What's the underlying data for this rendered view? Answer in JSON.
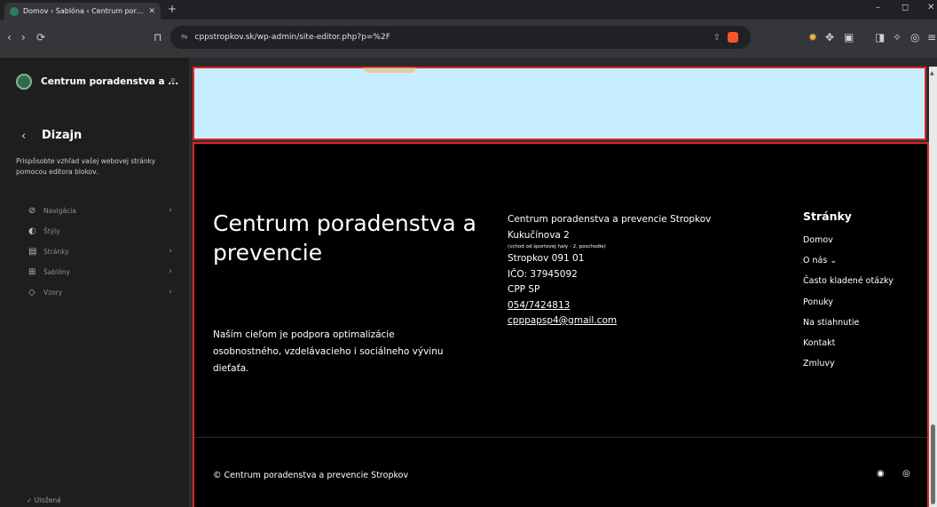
{
  "browser": {
    "tab_title": "Domov ‹ Šablóna ‹ Centrum por…",
    "new_tab": "+",
    "tab_close": "✕",
    "url": "cppstropkov.sk/wp-admin/site-editor.php?p=%2F",
    "win_min": "–",
    "win_max": "◻",
    "win_close": "✕"
  },
  "sidebar": {
    "site_name": "Centrum poradenstva a ...",
    "back": "‹",
    "heading": "Dizajn",
    "description": "Prispôsobte vzhľad vašej webovej stránky pomocou editora blokov.",
    "items": [
      {
        "label": "Navigácia",
        "icon": "compass-icon",
        "glyph": "⊘",
        "chevron": "›"
      },
      {
        "label": "Štýly",
        "icon": "half-circle-icon",
        "glyph": "◐",
        "chevron": ""
      },
      {
        "label": "Stránky",
        "icon": "page-icon",
        "glyph": "▤",
        "chevron": "›"
      },
      {
        "label": "Šablóny",
        "icon": "layout-icon",
        "glyph": "⊞",
        "chevron": "›"
      },
      {
        "label": "Vzory",
        "icon": "symbol-icon",
        "glyph": "◇",
        "chevron": "›"
      }
    ],
    "saved": "✓  Uložené"
  },
  "footer": {
    "title": "Centrum poradenstva a prevencie",
    "intro": "Naším cieľom je podpora optimalizácie osobnostného, vzdelávacieho i sociálneho vývinu dieťaťa.",
    "address": {
      "org": "Centrum poradenstva a prevencie Stropkov",
      "street": "Kukučínova 2",
      "note": "(vchod od športovej haly - 2. poschodie)",
      "city": "Stropkov 091 01",
      "ico": "IČO: 37945092",
      "abbr": "CPP SP",
      "phone": "054/7424813",
      "email": "cpppapsp4@gmail.com"
    },
    "pages": {
      "heading": "Stránky",
      "links": [
        "Domov",
        "O nás ⌄",
        "Často kladené otázky",
        "Ponuky",
        "Na stiahnutie",
        "Kontakt",
        "Zmluvy"
      ]
    },
    "copyright": "© Centrum poradenstva a prevencie Stropkov"
  }
}
